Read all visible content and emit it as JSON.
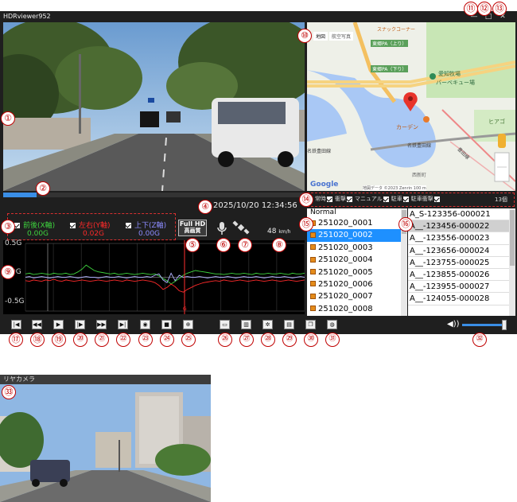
{
  "app": {
    "title": "HDRviewer952",
    "window_controls": [
      "minimize",
      "maximize",
      "close"
    ]
  },
  "callouts": [
    "①",
    "②",
    "③",
    "④",
    "⑤",
    "⑥",
    "⑦",
    "⑧",
    "⑨",
    "⑩",
    "⑪",
    "⑫",
    "⑬",
    "⑭",
    "⑮",
    "⑯",
    "⑰",
    "⑱",
    "⑲",
    "⑳",
    "㉑",
    "㉒",
    "㉓",
    "㉔",
    "㉕",
    "㉖",
    "㉗",
    "㉘",
    "㉙",
    "㉚",
    "㉛",
    "㉜",
    "㉝"
  ],
  "playback": {
    "progress_fraction": 0.11
  },
  "datetime": "2025/10/20 12:34:56",
  "gsensor": {
    "x": {
      "label": "前後(X軸)",
      "value": "0.00G",
      "color": "#3ed43e"
    },
    "y": {
      "label": "左右(Y軸)",
      "value": "0.02G",
      "color": "#ff2a2a"
    },
    "z": {
      "label": "上下(Z軸)",
      "value": "0.00G",
      "color": "#8c8cff"
    }
  },
  "fullhd": {
    "line1": "Full HD",
    "line2": "高画質"
  },
  "speed": {
    "value": "48",
    "unit": "km/h"
  },
  "graph": {
    "ylabels": [
      "0.5G",
      "0G",
      "-0.5G"
    ],
    "cursor_label": "G",
    "series": [
      {
        "name": "X",
        "color": "#3ed43e",
        "values": [
          0.05,
          0.06,
          0.04,
          0.05,
          0.06,
          0.05,
          0.04,
          0.06,
          0.05,
          0.05,
          0.06,
          0.04,
          0.05,
          0.08,
          0.12,
          0.18,
          0.14,
          0.1,
          0.08,
          0.07,
          0.06,
          0.05,
          0.06,
          0.04,
          0.05,
          0.06,
          0.05,
          0.04,
          0.05,
          0.06,
          0.05,
          0.04,
          0.05,
          0.02,
          -0.02,
          -0.05,
          -0.1,
          -0.06,
          -0.02,
          0.03,
          0.06,
          0.08,
          0.1,
          0.09,
          0.08,
          0.07,
          0.06,
          0.05,
          0.05,
          0.04,
          0.05,
          0.06,
          0.05,
          0.05,
          0.06,
          0.05,
          0.04,
          0.06,
          0.05,
          0.05,
          0.06,
          0.05,
          0.05,
          0.06,
          0.05,
          0.04,
          0.06,
          0.05,
          0.05,
          0.06
        ]
      },
      {
        "name": "Y",
        "color": "#ff2a2a",
        "values": [
          -0.05,
          -0.06,
          -0.04,
          -0.05,
          -0.06,
          -0.04,
          -0.05,
          -0.03,
          -0.05,
          -0.06,
          -0.04,
          -0.05,
          -0.06,
          -0.05,
          -0.04,
          -0.05,
          -0.06,
          -0.05,
          -0.04,
          -0.05,
          -0.06,
          -0.05,
          -0.04,
          -0.05,
          -0.06,
          -0.04,
          -0.05,
          -0.06,
          -0.05,
          -0.04,
          -0.05,
          -0.06,
          -0.08,
          -0.12,
          -0.18,
          -0.15,
          -0.1,
          -0.14,
          -0.2,
          -0.22,
          -0.18,
          -0.15,
          -0.12,
          -0.1,
          -0.08,
          -0.07,
          -0.06,
          -0.05,
          -0.06,
          -0.04,
          -0.05,
          -0.06,
          -0.05,
          -0.04,
          -0.05,
          -0.06,
          -0.05,
          -0.04,
          -0.05,
          -0.06,
          -0.05,
          -0.04,
          -0.05,
          -0.06,
          -0.05,
          -0.04,
          -0.05,
          -0.06,
          -0.05,
          -0.04
        ]
      },
      {
        "name": "Z",
        "color": "#b0b0ff",
        "values": [
          0.0,
          0.01,
          -0.01,
          0.0,
          0.01,
          0.0,
          -0.01,
          0.0,
          0.01,
          0.0,
          0.0,
          0.01,
          0.0,
          -0.01,
          0.0,
          0.01,
          0.0,
          0.0,
          -0.01,
          0.0,
          0.01,
          0.0,
          0.0,
          0.01,
          0.0,
          -0.01,
          0.0,
          0.01,
          0.0,
          0.0,
          0.01,
          0.0,
          0.03,
          0.05,
          -0.04,
          -0.08,
          0.06,
          -0.05,
          0.03,
          0.0,
          0.01,
          0.0,
          0.0,
          0.01,
          0.0,
          -0.01,
          0.0,
          0.01,
          0.0,
          0.0,
          0.01,
          0.0,
          -0.01,
          0.0,
          0.01,
          0.0,
          0.0,
          0.01,
          0.0,
          -0.01,
          0.0,
          0.01,
          0.0,
          0.0,
          0.01,
          0.0,
          -0.01,
          0.0,
          0.01,
          0.0
        ]
      }
    ]
  },
  "map": {
    "tabs": [
      "地図",
      "航空写真"
    ],
    "labels": [
      "スナックコーナー",
      "東郷PA（上り）",
      "東郷PA（下り）",
      "愛知牧場",
      "バーベキュー場",
      "カーデン",
      "ヒアゴ",
      "名鉄豊田線",
      "西新町",
      "豊田線",
      "名鉄豊田線"
    ],
    "logo": "Google",
    "copyright": "地図データ ©2023 Zenrin   100 m"
  },
  "filter": {
    "items": [
      "常時",
      "衝撃",
      "マニュアル",
      "駐車",
      "駐車衝撃"
    ],
    "count": "13個"
  },
  "filelist": {
    "header": "Normal",
    "items": [
      "251020_0001",
      "251020_0002",
      "251020_0003",
      "251020_0004",
      "251020_0005",
      "251020_0006",
      "251020_0007",
      "251020_0008"
    ]
  },
  "platelist": {
    "items": [
      "A_S-123356-000021",
      "A__-123456-000022",
      "A__-123556-000023",
      "A__-123656-000024",
      "A__-123755-000025",
      "A__-123855-000026",
      "A__-123955-000027",
      "A__-124055-000028"
    ]
  },
  "toolbar": {
    "buttons": [
      "skip-start",
      "rewind",
      "play",
      "step",
      "fast-forward",
      "skip-end",
      "snapshot",
      "video-capture",
      "zoom",
      "folder",
      "delete",
      "settings",
      "save",
      "window",
      "language"
    ]
  },
  "rear": {
    "title": "リヤカメラ"
  }
}
